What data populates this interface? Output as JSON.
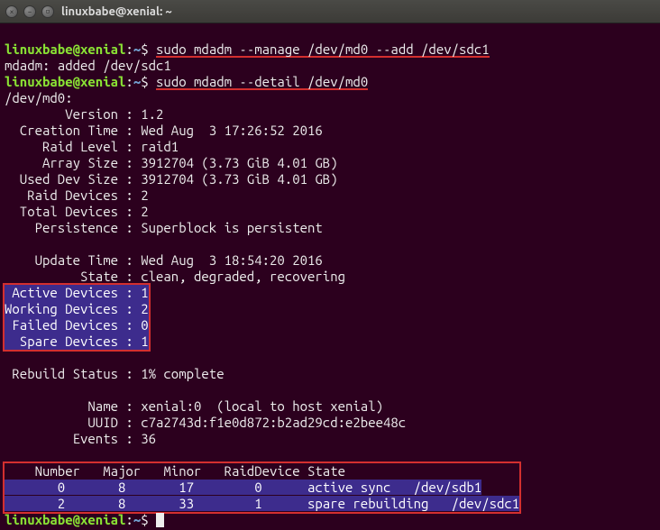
{
  "window": {
    "title": "linuxbabe@xenial: ~"
  },
  "prompt": {
    "user_host": "linuxbabe@xenial",
    "colon": ":",
    "path": "~",
    "sigil": "$ "
  },
  "cmd1": "sudo mdadm --manage /dev/md0 --add /dev/sdc1",
  "out1": "mdadm: added /dev/sdc1",
  "cmd2": "sudo mdadm --detail /dev/md0",
  "detail": {
    "dev": "/dev/md0:",
    "version": "        Version : 1.2",
    "creation": "  Creation Time : Wed Aug  3 17:26:52 2016",
    "raid_level": "     Raid Level : raid1",
    "array_size": "     Array Size : 3912704 (3.73 GiB 4.01 GB)",
    "used_dev": "  Used Dev Size : 3912704 (3.73 GiB 4.01 GB)",
    "raid_devices": "   Raid Devices : 2",
    "total_devices": "  Total Devices : 2",
    "persistence": "    Persistence : Superblock is persistent",
    "update_time": "    Update Time : Wed Aug  3 18:54:20 2016",
    "state": "          State : clean, degraded, recovering",
    "active": " Active Devices : 1",
    "working": "Working Devices : 2",
    "failed": " Failed Devices : 0",
    "spare": "  Spare Devices : 1",
    "rebuild": " Rebuild Status : 1% complete",
    "name": "           Name : xenial:0  (local to host xenial)",
    "uuid": "           UUID : c7a2743d:f1e0d872:b2ad29cd:e2bee48c",
    "events": "         Events : 36",
    "table_hdr": "    Number   Major   Minor   RaidDevice State",
    "table_row0": "       0       8       17        0      active sync   /dev/sdb1",
    "table_row1": "       2       8       33        1      spare rebuilding   /dev/sdc1"
  }
}
